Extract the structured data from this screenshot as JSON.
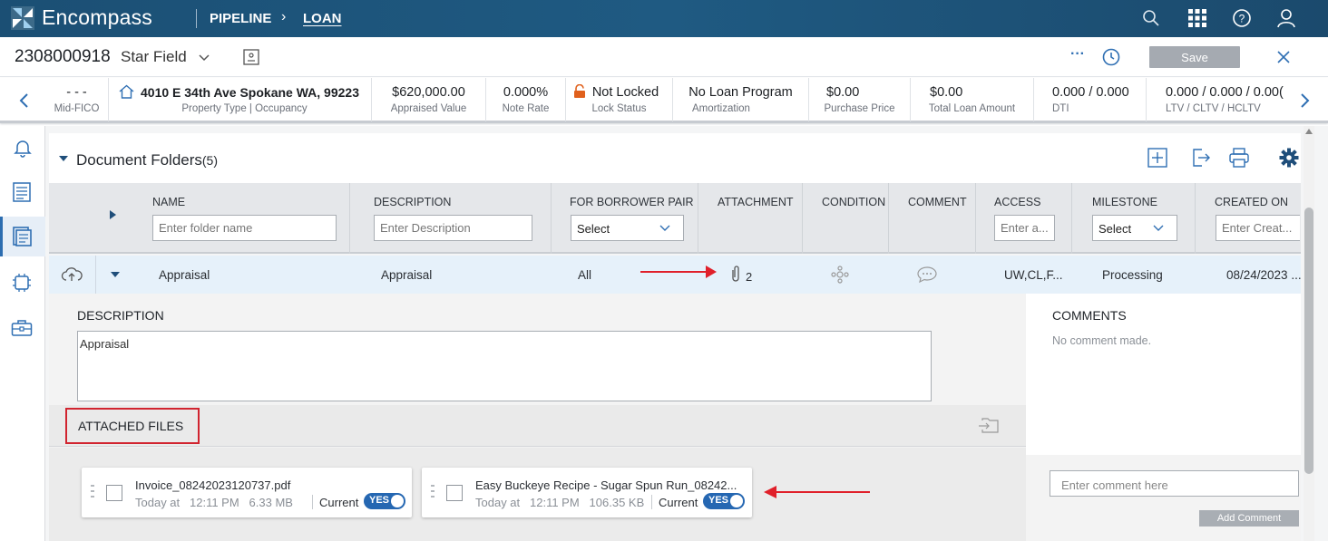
{
  "app": {
    "brand": "Encompass",
    "breadcrumbs": [
      "PIPELINE",
      "LOAN"
    ],
    "top_icons": [
      "search-icon",
      "apps-grid-icon",
      "help-icon",
      "user-icon"
    ]
  },
  "loan_header": {
    "loan_number": "2308000918",
    "borrower": "Star Field",
    "more": "···",
    "save_label": "Save"
  },
  "info_strip": [
    {
      "value": "- - -",
      "label": "Mid-FICO"
    },
    {
      "value": "4010 E 34th Ave Spokane WA, 99223",
      "label": "Property Type | Occupancy"
    },
    {
      "value": "$620,000.00",
      "label": "Appraised Value"
    },
    {
      "value": "0.000%",
      "label": "Note Rate"
    },
    {
      "value": "Not Locked",
      "label": "Lock Status"
    },
    {
      "value": "No Loan Program",
      "label": "Amortization"
    },
    {
      "value": "$0.00",
      "label": "Purchase Price"
    },
    {
      "value": "$0.00",
      "label": "Total Loan Amount"
    },
    {
      "value": "0.000 / 0.000",
      "label": "DTI"
    },
    {
      "value": "0.000 / 0.000 / 0.00(",
      "label": "LTV / CLTV / HCLTV"
    }
  ],
  "folders": {
    "title": "Document Folders",
    "count": "(5)",
    "columns": {
      "name": "NAME",
      "description": "DESCRIPTION",
      "borrower_pair": "FOR BORROWER PAIR",
      "attachment": "ATTACHMENT",
      "condition": "CONDITION",
      "comment": "COMMENT",
      "access": "ACCESS",
      "milestone": "MILESTONE",
      "created_on": "CREATED ON"
    },
    "filters": {
      "name_placeholder": "Enter folder name",
      "description_placeholder": "Enter Description",
      "borrower_pair_value": "Select",
      "access_placeholder": "Enter a...",
      "milestone_value": "Select",
      "created_placeholder": "Enter Creat..."
    },
    "row": {
      "name": "Appraisal",
      "description": "Appraisal",
      "borrower_pair": "All",
      "attachment_count": "2",
      "access": "UW,CL,F...",
      "milestone": "Processing",
      "created_on": "08/24/2023 ..."
    }
  },
  "detail": {
    "description_label": "DESCRIPTION",
    "description_value": "Appraisal",
    "attached_files_label": "ATTACHED FILES",
    "files": [
      {
        "name": "Invoice_08242023120737.pdf",
        "date": "Today at",
        "time": "12:11 PM",
        "size": "6.33 MB",
        "current_label": "Current",
        "toggle": "YES"
      },
      {
        "name": "Easy Buckeye Recipe - Sugar Spun Run_08242...",
        "date": "Today at",
        "time": "12:11 PM",
        "size": "106.35 KB",
        "current_label": "Current",
        "toggle": "YES"
      }
    ]
  },
  "comments": {
    "label": "COMMENTS",
    "empty": "No comment made.",
    "input_placeholder": "Enter comment here",
    "add_label": "Add Comment"
  },
  "colors": {
    "topbar": "#1f5a82",
    "accent": "#2567b2",
    "highlight": "#d1242f"
  }
}
